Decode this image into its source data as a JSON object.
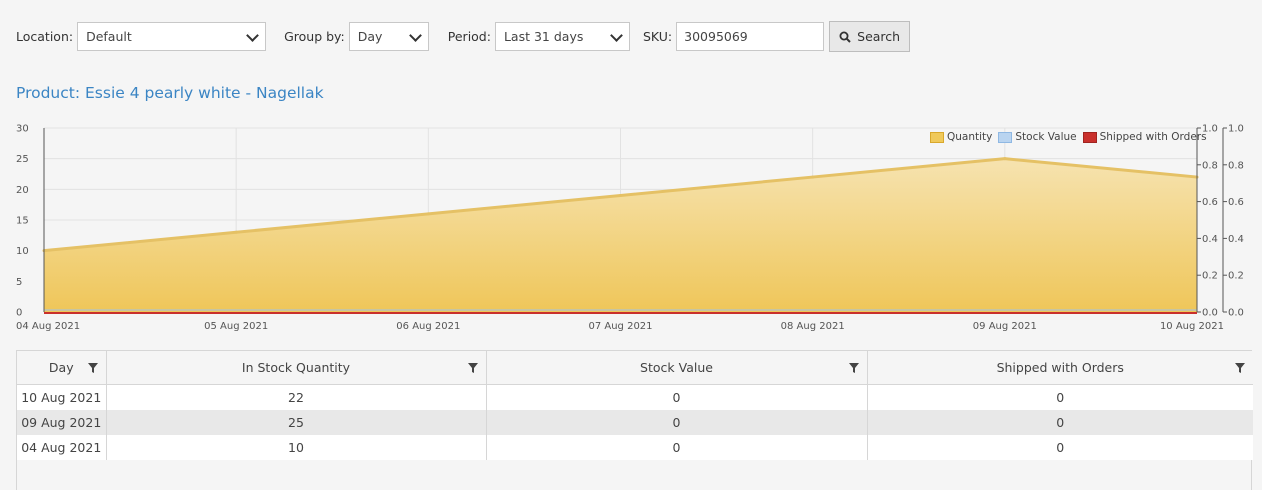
{
  "filters": {
    "location_label": "Location:",
    "location_value": "Default",
    "group_label": "Group by:",
    "group_value": "Day",
    "period_label": "Period:",
    "period_value": "Last 31 days",
    "sku_label": "SKU:",
    "sku_value": "30095069",
    "search_label": "Search"
  },
  "product_title": "Product: Essie 4 pearly white - Nagellak",
  "legend": [
    {
      "label": "Quantity",
      "color": "#f0c95a"
    },
    {
      "label": "Stock Value",
      "color": "#b9d4f0"
    },
    {
      "label": "Shipped with Orders",
      "color": "#c9302c"
    }
  ],
  "chart_data": {
    "type": "area",
    "x": [
      "04 Aug 2021",
      "05 Aug 2021",
      "06 Aug 2021",
      "07 Aug 2021",
      "08 Aug 2021",
      "09 Aug 2021",
      "10 Aug 2021"
    ],
    "series": [
      {
        "name": "Quantity",
        "values": [
          10,
          13,
          16,
          19,
          22,
          25,
          22
        ]
      },
      {
        "name": "Stock Value",
        "values": [
          0,
          0,
          0,
          0,
          0,
          0,
          0
        ]
      },
      {
        "name": "Shipped with Orders",
        "values": [
          0,
          0,
          0,
          0,
          0,
          0,
          0
        ]
      }
    ],
    "y_left_ticks": [
      "0",
      "5",
      "10",
      "15",
      "20",
      "25",
      "30"
    ],
    "y_right_ticks": [
      "0.0",
      "0.2",
      "0.4",
      "0.6",
      "0.8",
      "1.0"
    ],
    "ylim_left": [
      0,
      30
    ],
    "ylim_right": [
      0,
      1
    ],
    "grid": true,
    "legend_position": "top-right"
  },
  "table": {
    "columns": [
      "Day",
      "In Stock Quantity",
      "Stock Value",
      "Shipped with Orders"
    ],
    "rows": [
      [
        "10 Aug 2021",
        "22",
        "0",
        "0"
      ],
      [
        "09 Aug 2021",
        "25",
        "0",
        "0"
      ],
      [
        "04 Aug 2021",
        "10",
        "0",
        "0"
      ]
    ]
  }
}
